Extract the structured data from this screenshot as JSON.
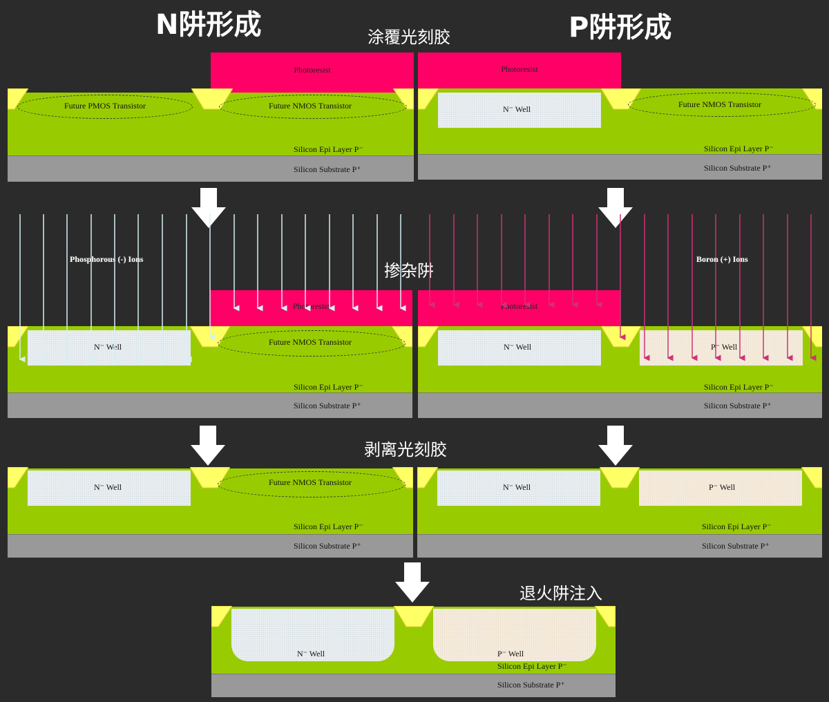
{
  "titles": {
    "n_well": "N阱形成",
    "p_well": "P阱形成"
  },
  "steps": {
    "coat": "涂覆光刻胶",
    "dope": "掺杂阱",
    "strip": "剥离光刻胶",
    "anneal": "退火阱注入"
  },
  "labels": {
    "photoresist": "Photoresist",
    "future_pmos": "Future PMOS Transistor",
    "future_nmos": "Future NMOS Transistor",
    "n_well": "N⁻ Well",
    "p_well": "P⁻ Well",
    "epi": "Silicon Epi Layer  P⁻",
    "substrate": "Silicon Substrate  P⁺",
    "phos_ions": "Phosphorous (-) Ions",
    "boron_ions": "Boron (+) Ions"
  },
  "colors": {
    "background": "#2b2b2b",
    "photoresist": "#ff0066",
    "epi": "#99cc00",
    "substrate": "#999999",
    "field_oxide": "#ffff66",
    "n_well": "#e8edf0",
    "p_well": "#f5ebdc",
    "phos_ion": "#d6f0f4",
    "boron_ion": "#cc3377"
  },
  "icons": {
    "process_arrow": "down-arrow-icon",
    "field_oxide": "field-oxide-shape"
  }
}
